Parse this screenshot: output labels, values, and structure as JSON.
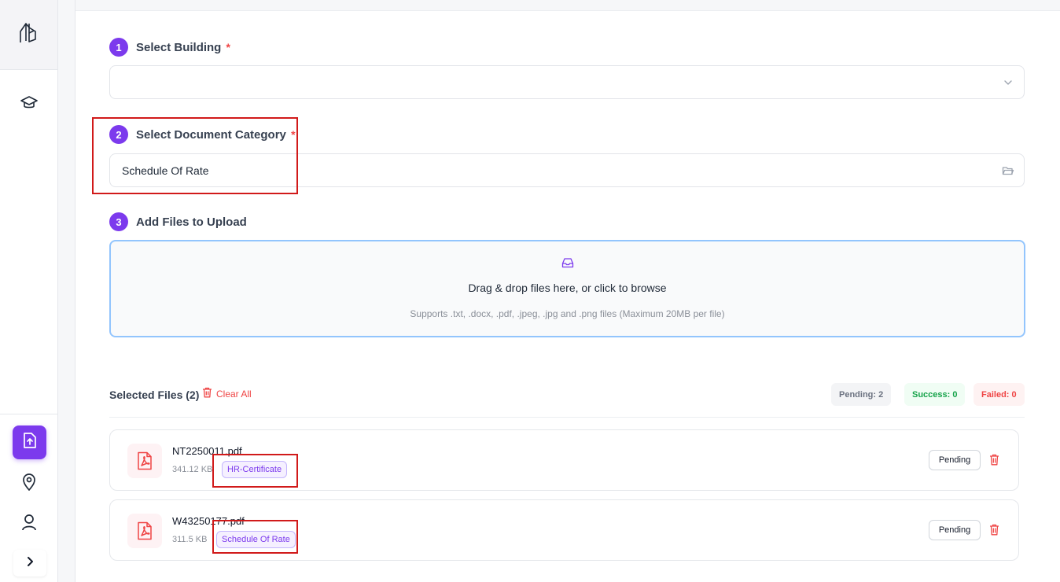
{
  "steps": [
    {
      "number": "1",
      "label": "Select Building",
      "required": "*"
    },
    {
      "number": "2",
      "label": "Select Document Category",
      "required": "*"
    },
    {
      "number": "3",
      "label": "Add Files to Upload"
    }
  ],
  "building_select": {
    "value": ""
  },
  "category_select": {
    "value": "Schedule Of Rate"
  },
  "dropzone": {
    "title": "Drag & drop files here, or click to browse",
    "subtitle": "Supports .txt, .docx, .pdf, .jpeg, .jpg and .png files (Maximum 20MB per file)"
  },
  "files_section": {
    "title": "Selected Files (2)",
    "clear_all": "Clear All",
    "pending": "Pending: 2",
    "success": "Success: 0",
    "failed": "Failed: 0"
  },
  "files": [
    {
      "name": "NT2250011.pdf",
      "size": "341.12 KB",
      "tag": "HR-Certificate",
      "status": "Pending"
    },
    {
      "name": "W43250177.pdf",
      "size": "311.5 KB",
      "tag": "Schedule Of Rate",
      "status": "Pending"
    }
  ],
  "colors": {
    "accent": "#7c3aed",
    "danger": "#ef4444",
    "success": "#16a34a",
    "highlight": "#d11a1a"
  },
  "icons": [
    "app-logo-icon",
    "graduation-cap-icon",
    "upload-file-icon",
    "location-pin-icon",
    "user-icon",
    "chevron-right-icon",
    "chevron-down-icon",
    "folder-icon",
    "inbox-icon",
    "trash-icon",
    "pdf-file-icon"
  ]
}
